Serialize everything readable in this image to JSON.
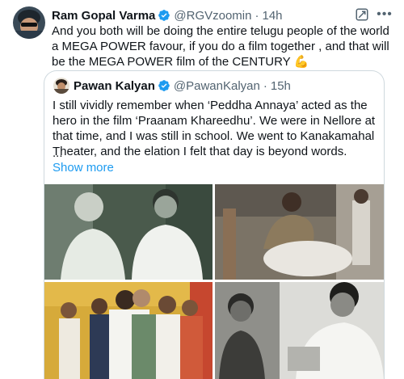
{
  "post": {
    "author": {
      "name": "Ram Gopal Varma",
      "handle": "@RGVzoomin",
      "time": "14h",
      "verified": true
    },
    "separator": "·",
    "text": "And you both will be doing the entire telugu people of the world  a MEGA POWER favour,  if you do a film together , and that will be the MEGA POWER film of the CENTURY 💪",
    "icons": [
      "grok-icon",
      "more-icon"
    ]
  },
  "quoted": {
    "author": {
      "name": "Pawan Kalyan",
      "handle": "@PawanKalyan",
      "time": "15h",
      "verified": true
    },
    "text": "I still vividly remember when ‘Peddha Annaya’ acted as the hero in the film ‘Praanam Khareedhu’. We were in Nellore at that time, and I was still in school. We went to Kanakamahal Theater, and the elation I felt that day is beyond words.",
    "ellipsis": "...",
    "show_more": "Show more",
    "photos": [
      {
        "kind": "black-and-white photo"
      },
      {
        "kind": "sepia photo"
      },
      {
        "kind": "color event photo"
      },
      {
        "kind": "black-and-white photo"
      }
    ]
  },
  "colors": {
    "accent": "#1d9bf0",
    "secondary_text": "#536471",
    "border": "#cfd9de",
    "verified_badge": "#1d9bf0"
  }
}
